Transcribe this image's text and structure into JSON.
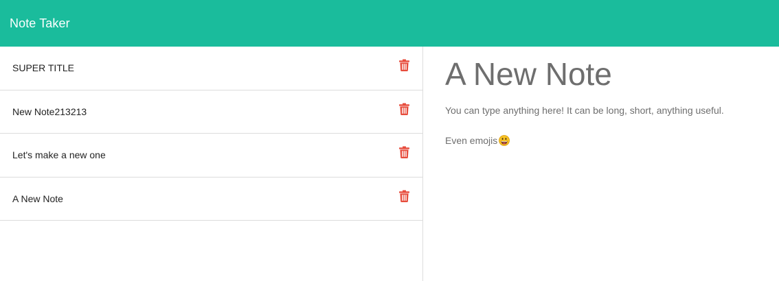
{
  "app": {
    "brand": "Note Taker"
  },
  "notes": [
    {
      "title": "SUPER TITLE"
    },
    {
      "title": "New Note213213"
    },
    {
      "title": "Let's make a new one"
    },
    {
      "title": "A New Note"
    }
  ],
  "active_note": {
    "title": "A New Note",
    "text_line_1": "You can type anything here! It can be long, short, anything useful.",
    "text_line_2": "Even emojis"
  },
  "icons": {
    "delete": "trash-icon",
    "emoji": "grinning-face-icon"
  },
  "colors": {
    "navbar": "#1abc9c",
    "delete_icon": "#e74c3c",
    "note_text": "#6e6e6e"
  }
}
